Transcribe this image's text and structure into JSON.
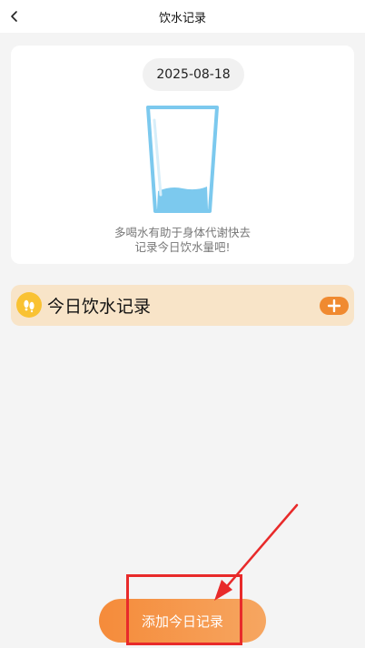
{
  "header": {
    "title": "饮水记录",
    "back_icon": "chevron-left-icon"
  },
  "card": {
    "date": "2025-08-18",
    "glass_icon": "water-glass-icon",
    "hint_line1": "多喝水有助于身体代谢快去",
    "hint_line2": "记录今日饮水量吧!"
  },
  "records": {
    "title": "今日饮水记录",
    "badge_icon": "footprints-icon",
    "add_icon": "plus-icon"
  },
  "footer": {
    "add_button_label": "添加今日记录"
  },
  "colors": {
    "accent": "#f08a30",
    "record_bar_bg": "#f8e4c8",
    "badge_yellow": "#f9c233",
    "water_blue": "#7cc9ee",
    "annotation_red": "#e82a2a"
  }
}
